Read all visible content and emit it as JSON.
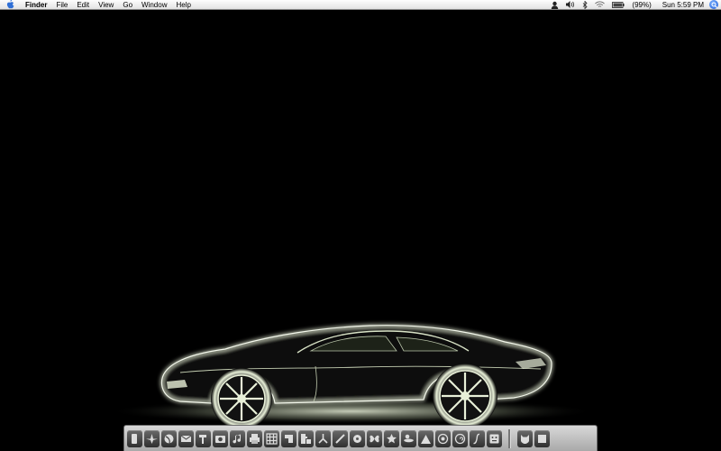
{
  "menubar": {
    "app_name": "Finder",
    "menus": [
      "File",
      "Edit",
      "View",
      "Go",
      "Window",
      "Help"
    ],
    "battery_percent": "(99%)",
    "clock": "Sun 5:59 PM"
  },
  "status_icons": [
    "user-icon",
    "volume-icon",
    "bluetooth-icon",
    "wifi-icon",
    "battery-icon",
    "spotlight-icon"
  ],
  "wallpaper": {
    "subject": "glowing sketch of a sports car on black background",
    "glow_color": "#e8f0d8"
  },
  "dock": {
    "apps": [
      "finder-icon",
      "compass-icon",
      "globe-icon",
      "mail-icon",
      "hammer-icon",
      "camera-icon",
      "music-note-icon",
      "printer-icon",
      "grid-icon",
      "terminal-icon",
      "puzzle-icon",
      "share-icon",
      "brush-icon",
      "gear-flower-icon",
      "butterfly-icon",
      "star-icon",
      "duck-icon",
      "mountain-icon",
      "aperture-icon",
      "spiral-icon",
      "script-icon",
      "calculator-icon"
    ],
    "docs": [
      "cat-icon",
      "trash-icon"
    ]
  }
}
